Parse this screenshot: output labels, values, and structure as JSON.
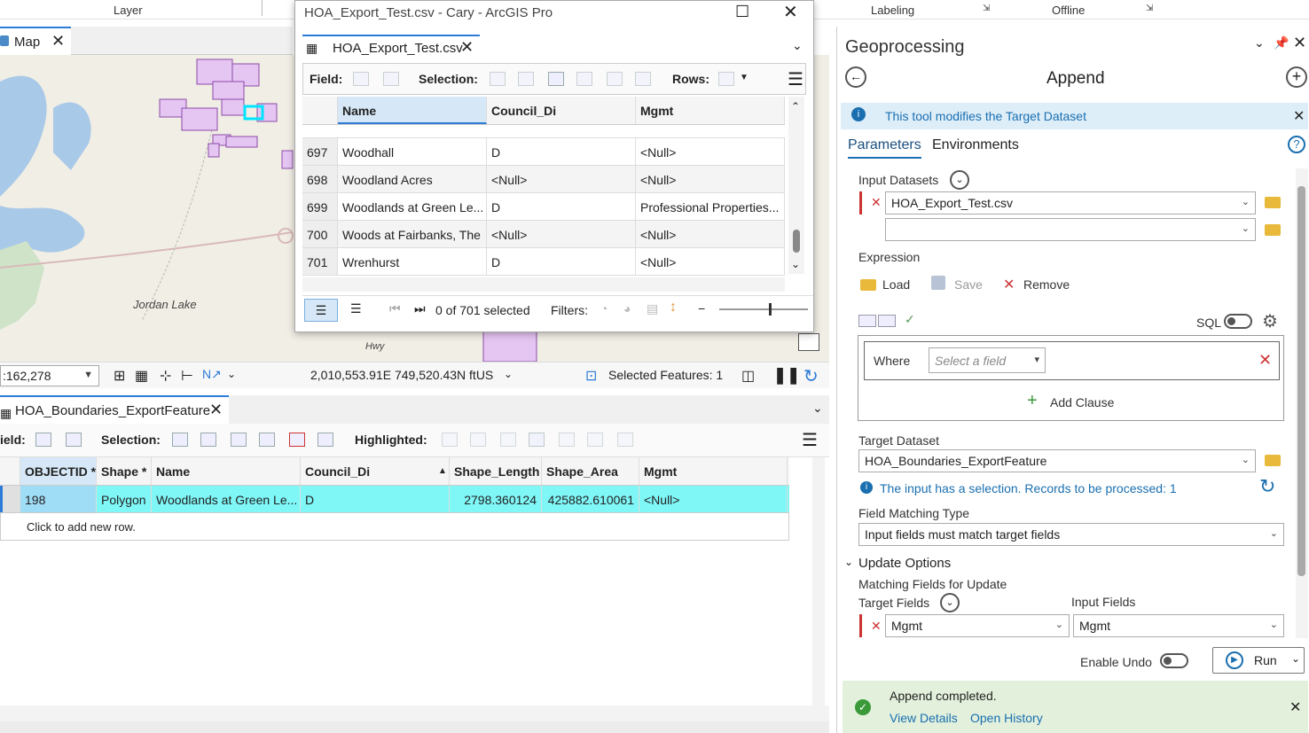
{
  "ribbon": {
    "layer": "Layer",
    "labeling": "Labeling",
    "offline": "Offline"
  },
  "map": {
    "tab_label": "Map",
    "place_label": "Jordan Lake",
    "road_label": "Hwy",
    "scale": ":162,278",
    "coords": "2,010,553.91E 749,520.43N ftUS",
    "selected_features": "Selected Features: 1"
  },
  "popup": {
    "title": "HOA_Export_Test.csv - Cary - ArcGIS Pro",
    "tab": "HOA_Export_Test.csv",
    "field_label": "Field:",
    "selection_label": "Selection:",
    "rows_label": "Rows:",
    "columns": [
      "Name",
      "Council_Di",
      "Mgmt"
    ],
    "rows": [
      {
        "id": "697",
        "name": "Woodhall",
        "council": "D",
        "mgmt": "<Null>"
      },
      {
        "id": "698",
        "name": "Woodland Acres",
        "council": "<Null>",
        "mgmt": "<Null>"
      },
      {
        "id": "699",
        "name": "Woodlands at Green Le...",
        "council": "D",
        "mgmt": "Professional Properties..."
      },
      {
        "id": "700",
        "name": "Woods at Fairbanks, The",
        "council": "<Null>",
        "mgmt": "<Null>"
      },
      {
        "id": "701",
        "name": "Wrenhurst",
        "council": "D",
        "mgmt": "<Null>"
      }
    ],
    "selected_count": "0 of 701 selected",
    "filters_label": "Filters:"
  },
  "table": {
    "tab": "HOA_Boundaries_ExportFeature",
    "field_label": "ield:",
    "selection_label": "Selection:",
    "highlighted_label": "Highlighted:",
    "columns": [
      "OBJECTID *",
      "Shape *",
      "Name",
      "Council_Di",
      "Shape_Length",
      "Shape_Area",
      "Mgmt"
    ],
    "row": {
      "objectid": "198",
      "shape": "Polygon",
      "name": "Woodlands at Green Le...",
      "council": "D",
      "length": "2798.360124",
      "area": "425882.610061",
      "mgmt": "<Null>"
    },
    "add_row": "Click to add new row."
  },
  "gp": {
    "title": "Geoprocessing",
    "tool": "Append",
    "info": "This tool modifies the Target Dataset",
    "tab_params": "Parameters",
    "tab_env": "Environments",
    "input_datasets_label": "Input Datasets",
    "input_dataset_value": "HOA_Export_Test.csv",
    "expression_label": "Expression",
    "load": "Load",
    "save": "Save",
    "remove": "Remove",
    "sql": "SQL",
    "where": "Where",
    "select_field_placeholder": "Select a field",
    "add_clause": "Add Clause",
    "target_dataset_label": "Target Dataset",
    "target_dataset_value": "HOA_Boundaries_ExportFeature",
    "selection_note": "The input has a selection. Records to be processed: 1",
    "field_matching_label": "Field Matching Type",
    "field_matching_value": "Input fields must match target fields",
    "update_options": "Update Options",
    "matching_fields_label": "Matching Fields for Update",
    "target_fields_label": "Target Fields",
    "input_fields_label": "Input Fields",
    "target_field_value": "Mgmt",
    "input_field_value": "Mgmt",
    "enable_undo": "Enable Undo",
    "run": "Run",
    "completed": "Append completed.",
    "view_details": "View Details",
    "open_history": "Open History"
  }
}
